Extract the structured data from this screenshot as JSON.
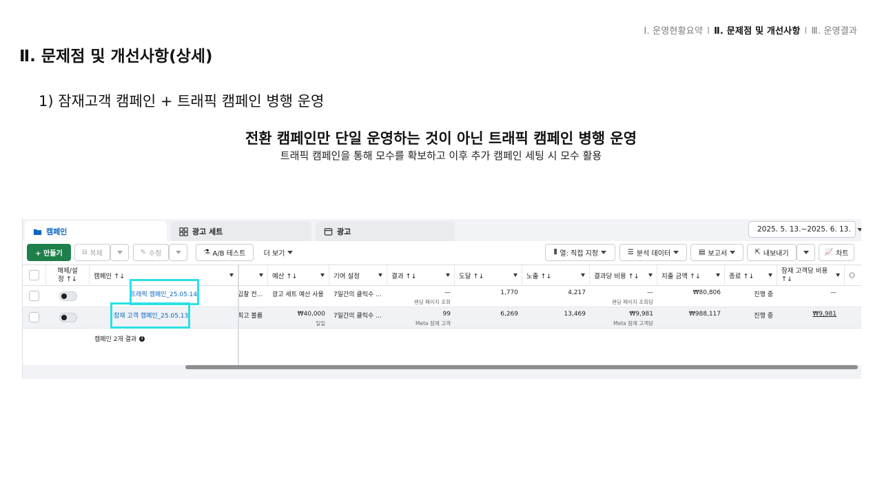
{
  "nav": {
    "item1": "Ⅰ. 운영현황요약",
    "sep1": "Ⅰ",
    "item2": "Ⅱ. 문제점 및 개선사항",
    "sep2": "Ⅰ",
    "item3": "Ⅲ. 운영결과"
  },
  "slide": {
    "title": "Ⅱ. 문제점 및 개선사항(상세)",
    "subtitle": "1) 잠재고객 캠페인 + 트래픽 캠페인 병행 운영",
    "headline": "전환 캠페인만 단일 운영하는 것이 아닌 트래픽 캠페인 병행 운영",
    "subline": "트래픽 캠페인을 통해 모수를 확보하고 이후 추가 캠페인 세팅 시 모수 활용"
  },
  "tabs": {
    "campaign": "캠페인",
    "adset": "광고 세트",
    "ad": "광고",
    "date_range": "2025. 5. 13.~2025. 6. 13."
  },
  "toolbar": {
    "create": "+ 만들기",
    "duplicate": "복제",
    "edit": "수정",
    "ab_test": "A/B 테스트",
    "more": "더 보기",
    "columns": "열: 직접 지정",
    "breakdown": "분석 데이터",
    "reports": "보고서",
    "export": "내보내기",
    "chart": "차트"
  },
  "headers": {
    "onoff": "해제/설\n정 ↑↓",
    "campaign": "캠페인 ↑↓",
    "budget": "예산 ↑↓",
    "attribution": "기여 설정",
    "results": "결과 ↑↓",
    "reach": "도달 ↑↓",
    "impressions": "노출 ↑↓",
    "cost_per_result": "결과당 비용 ↑↓",
    "amount_spent": "지출 금액 ↑↓",
    "ends": "종료 ↑↓",
    "cost_per_lead": "잠재 고객당 비용\n↑↓"
  },
  "rows": [
    {
      "campaign": "트래픽 캠페인_25.05.14",
      "bid": "입찰 전...",
      "budget": "광고 세트 예산 사용",
      "attribution": "7일간의 클릭수 ...",
      "results": "—",
      "results_sub": "랜딩 페이지 조회",
      "reach": "1,770",
      "impressions": "4,217",
      "cost_per_result": "—",
      "cost_per_result_sub": "랜딩 페이지 조회당",
      "amount_spent": "₩80,806",
      "ends": "진행 중",
      "cost_per_lead": "—"
    },
    {
      "campaign": "잠재 고객 캠페인_25.05.13",
      "bid": "최고 볼륨",
      "budget": "₩40,000",
      "budget_sub": "일일",
      "attribution": "7일간의 클릭수 ...",
      "results": "99",
      "results_sub": "Meta 잠재 고객",
      "reach": "6,269",
      "impressions": "13,469",
      "cost_per_result": "₩9,981",
      "cost_per_result_sub": "Meta 잠재 고객당",
      "amount_spent": "₩988,117",
      "ends": "진행 중",
      "cost_per_lead": "₩9,981"
    }
  ],
  "footer": {
    "result_count": "캠페인 2개 결과"
  },
  "colors": {
    "link": "#0a66c2",
    "highlight": "#29e0e6",
    "create_button": "#1e7f4b"
  }
}
